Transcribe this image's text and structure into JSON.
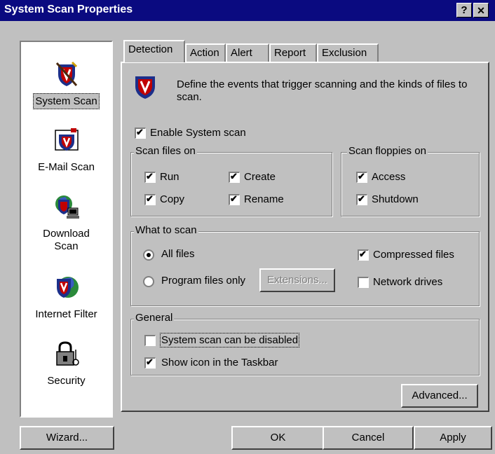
{
  "window": {
    "title": "System Scan Properties",
    "help_btn": "?",
    "close_btn": "✕"
  },
  "sidebar": {
    "items": [
      {
        "label": "System Scan",
        "selected": true
      },
      {
        "label": "E-Mail Scan"
      },
      {
        "label": "Download Scan"
      },
      {
        "label": "Internet Filter"
      },
      {
        "label": "Security"
      }
    ]
  },
  "tabs": [
    "Detection",
    "Action",
    "Alert",
    "Report",
    "Exclusion"
  ],
  "detection": {
    "description": "Define the events that trigger scanning and the kinds of files to scan.",
    "enable_label": "Enable System scan",
    "enable_checked": true,
    "scan_files_on": {
      "title": "Scan files on",
      "run": "Run",
      "create": "Create",
      "copy": "Copy",
      "rename": "Rename"
    },
    "scan_floppies_on": {
      "title": "Scan floppies on",
      "access": "Access",
      "shutdown": "Shutdown"
    },
    "what_to_scan": {
      "title": "What to scan",
      "all_files": "All files",
      "program_files_only": "Program files only",
      "extensions": "Extensions...",
      "compressed_files": "Compressed files",
      "network_drives": "Network drives"
    },
    "general": {
      "title": "General",
      "disable_label": "System scan can be disabled",
      "taskbar_label": "Show icon in the Taskbar"
    },
    "advanced_btn": "Advanced..."
  },
  "footer": {
    "wizard": "Wizard...",
    "ok": "OK",
    "cancel": "Cancel",
    "apply": "Apply"
  },
  "colors": {
    "title_bg": "#0a0a80",
    "face": "#c0c0c0",
    "shield_red": "#c00000",
    "shield_blue": "#1c2f8a"
  }
}
